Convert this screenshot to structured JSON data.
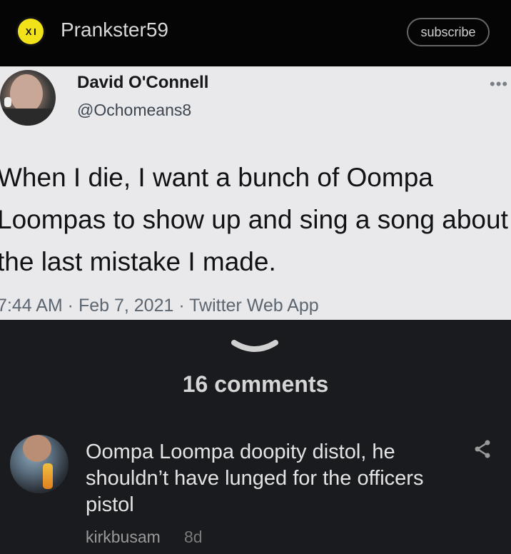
{
  "header": {
    "logo_text": "X I",
    "channel_name": "Prankster59",
    "subscribe_label": "subscribe"
  },
  "tweet": {
    "author_name": "David O'Connell",
    "handle": "@Ochomeans8",
    "more_icon": "•••",
    "text": "When I die, I want a bunch of Oompa Loompas to show up and sing a song about the last mistake I made.",
    "meta": "7:44 AM · Feb 7, 2021 · Twitter Web App"
  },
  "comments_section": {
    "count_label": "16 comments"
  },
  "comment": {
    "text": "Oompa Loompa doopity distol, he shouldn’t have lunged for the officers pistol",
    "username": "kirkbusam",
    "age": "8d"
  },
  "colors": {
    "background": "#1a1b1f",
    "topbar": "#050506",
    "tweet_bg": "#e9e9eb",
    "logo_yellow": "#f2e21a"
  }
}
